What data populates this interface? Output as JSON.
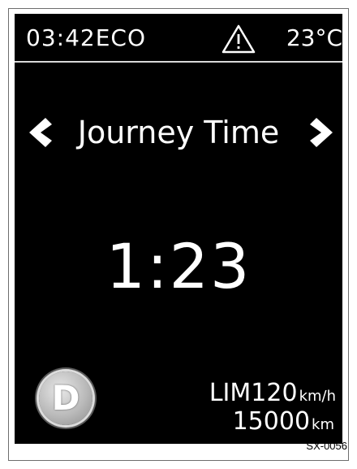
{
  "status_bar": {
    "time": "03:42",
    "mode": "ECO",
    "warning_icon": "warning-triangle-icon",
    "temperature": "23°C"
  },
  "menu": {
    "title": "Journey Time",
    "prev_icon": "chevron-left-icon",
    "next_icon": "chevron-right-icon"
  },
  "main": {
    "value": "1:23"
  },
  "gear": {
    "letter": "D"
  },
  "limit": {
    "label": "LIM",
    "value": "120",
    "unit": "km/h"
  },
  "odometer": {
    "value": "15000",
    "unit": "km"
  },
  "figure_code": "SX-0056",
  "colors": {
    "screen_bg": "#000000",
    "text": "#ffffff",
    "gear_badge": "#b9b9b9"
  }
}
